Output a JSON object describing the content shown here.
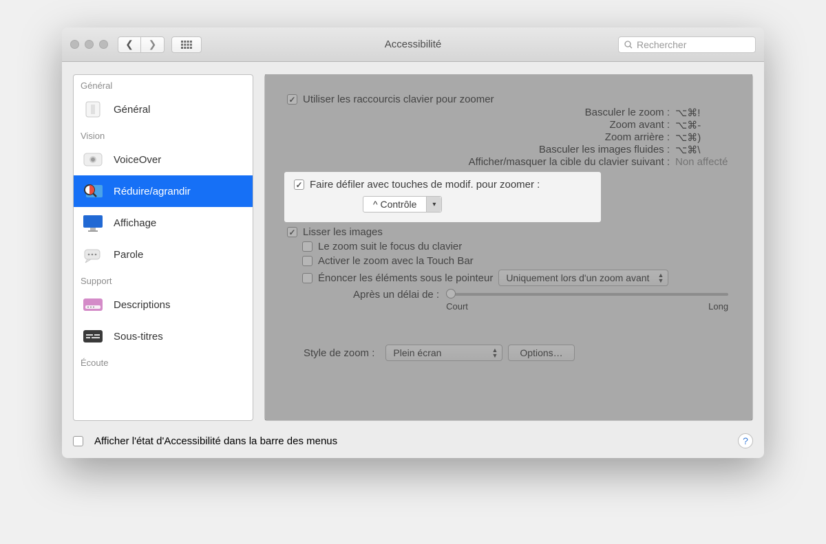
{
  "toolbar": {
    "title": "Accessibilité",
    "search_placeholder": "Rechercher"
  },
  "sidebar": {
    "groups": [
      {
        "label": "Général",
        "items": [
          {
            "id": "general",
            "label": "Général"
          }
        ]
      },
      {
        "label": "Vision",
        "items": [
          {
            "id": "voiceover",
            "label": "VoiceOver"
          },
          {
            "id": "zoom",
            "label": "Réduire/agrandir",
            "selected": true
          },
          {
            "id": "display",
            "label": "Affichage"
          },
          {
            "id": "speech",
            "label": "Parole"
          }
        ]
      },
      {
        "label": "Support",
        "items": [
          {
            "id": "descriptions",
            "label": "Descriptions"
          },
          {
            "id": "subtitles",
            "label": "Sous-titres"
          }
        ]
      },
      {
        "label": "Écoute",
        "items": []
      }
    ]
  },
  "main": {
    "use_keyboard_shortcuts": {
      "checked": true,
      "label": "Utiliser les raccourcis clavier pour zoomer"
    },
    "shortcuts": [
      {
        "label": "Basculer le zoom :",
        "value": "⌥⌘!"
      },
      {
        "label": "Zoom avant :",
        "value": "⌥⌘-"
      },
      {
        "label": "Zoom arrière :",
        "value": "⌥⌘)"
      },
      {
        "label": "Basculer les images fluides :",
        "value": "⌥⌘\\"
      },
      {
        "label": "Afficher/masquer la cible du clavier suivant :",
        "value": "Non affecté",
        "unassigned": true
      }
    ],
    "scroll_modifier": {
      "checked": true,
      "label": "Faire défiler avec touches de modif. pour zoomer :",
      "value": "^ Contrôle"
    },
    "smooth_images": {
      "checked": true,
      "label": "Lisser les images"
    },
    "follow_keyboard": {
      "checked": false,
      "label": "Le zoom suit le focus du clavier"
    },
    "touch_bar": {
      "checked": false,
      "label": "Activer le zoom avec la Touch Bar"
    },
    "speak_items": {
      "checked": false,
      "label": "Énoncer les éléments sous le pointeur",
      "dropdown": "Uniquement lors d'un zoom avant"
    },
    "delay": {
      "label": "Après un délai de :",
      "min_label": "Court",
      "max_label": "Long"
    },
    "zoom_style": {
      "label": "Style de zoom :",
      "value": "Plein écran",
      "options_label": "Options…"
    }
  },
  "footer": {
    "show_status": {
      "checked": false,
      "label": "Afficher l'état d'Accessibilité dans la barre des menus"
    }
  }
}
